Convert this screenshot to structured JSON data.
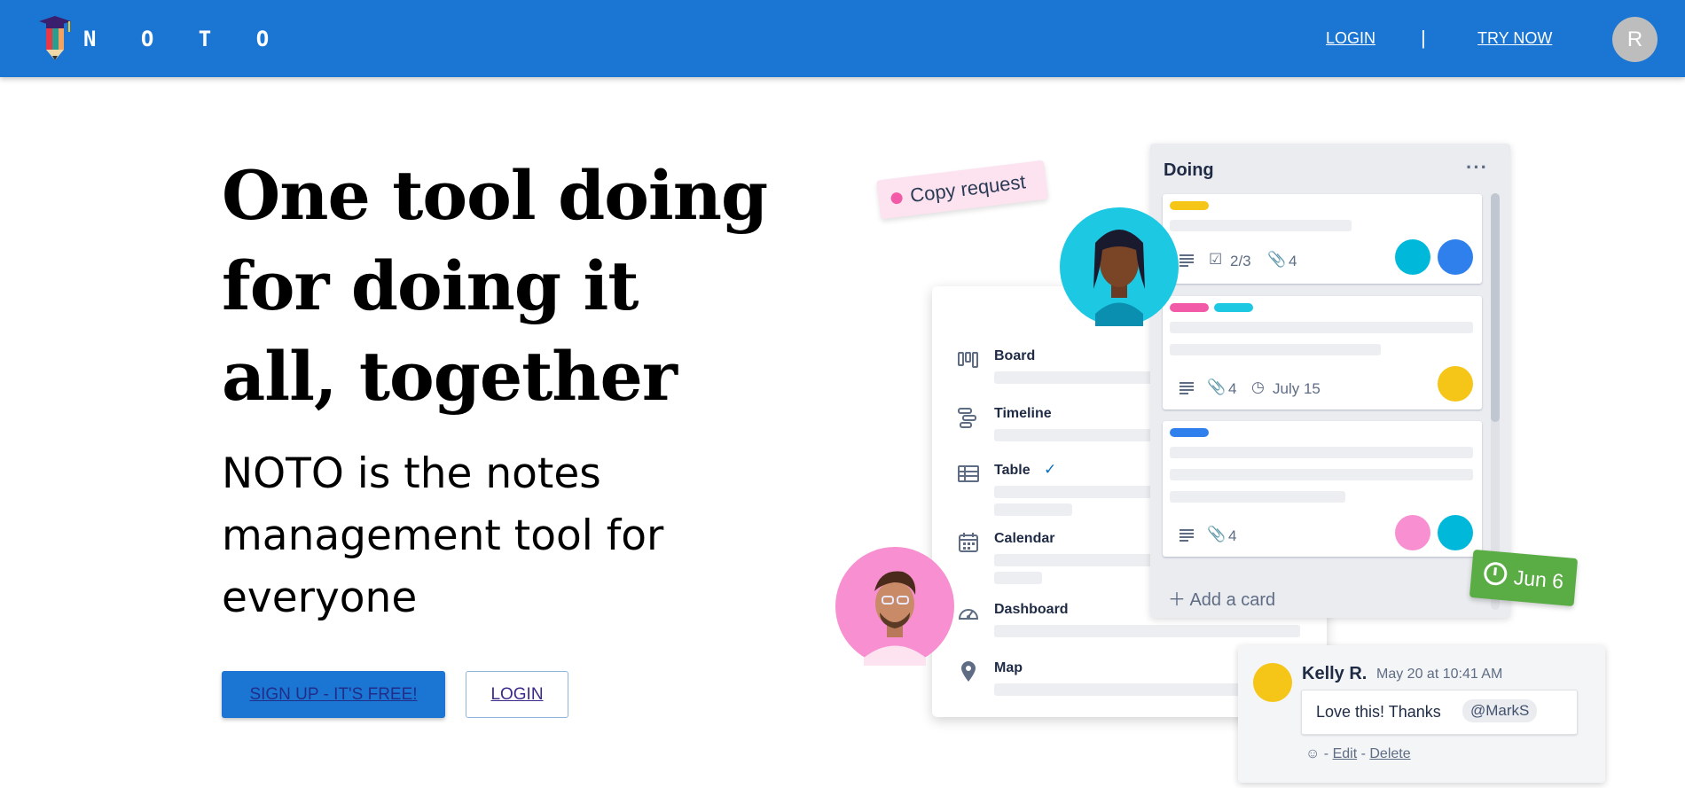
{
  "header": {
    "brand": "N O T O",
    "login_label": "LOGIN",
    "separator": "|",
    "try_label": "TRY NOW",
    "avatar_initial": "R",
    "bar_color": "#1b76d3"
  },
  "hero": {
    "title": "One tool doing for doing it all, together",
    "subtitle": "NOTO is the notes management tool for everyone",
    "signup_label": "SIGN UP - IT'S FREE!",
    "login_label": "LOGIN"
  },
  "illustration": {
    "copy_tag": "Copy request",
    "views": [
      {
        "label": "Board",
        "icon": "board-icon"
      },
      {
        "label": "Timeline",
        "icon": "timeline-icon"
      },
      {
        "label": "Table",
        "icon": "table-icon",
        "checked": true
      },
      {
        "label": "Calendar",
        "icon": "calendar-icon"
      },
      {
        "label": "Dashboard",
        "icon": "dashboard-icon"
      },
      {
        "label": "Map",
        "icon": "map-pin-icon"
      }
    ],
    "column": {
      "title": "Doing",
      "menu": "···",
      "cards": [
        {
          "checklist": "2/3",
          "attachments": "4"
        },
        {
          "attachments": "4",
          "due": "July 15"
        },
        {
          "attachments": "4"
        }
      ],
      "add_card": "Add a card"
    },
    "due_badge": "Jun 6",
    "comment": {
      "author": "Kelly R.",
      "time": "May 20 at 10:41 AM",
      "text": "Love this! Thanks",
      "mention": "@MarkS",
      "edit": "Edit",
      "delete": "Delete"
    }
  }
}
